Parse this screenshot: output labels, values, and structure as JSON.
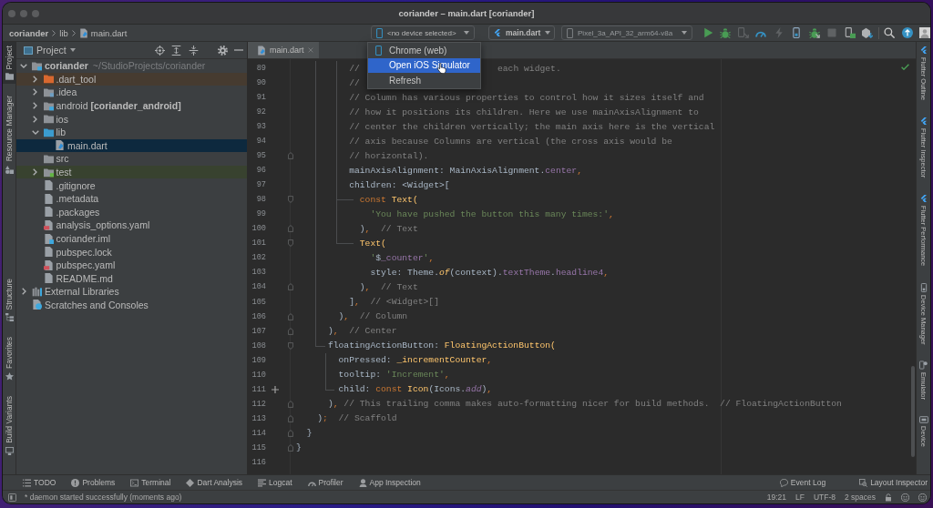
{
  "window": {
    "title": "coriander – main.dart [coriander]"
  },
  "breadcrumbs": [
    {
      "label": "coriander",
      "kind": "project"
    },
    {
      "label": "lib",
      "kind": "folder"
    },
    {
      "label": "main.dart",
      "kind": "dart"
    }
  ],
  "toolbar": {
    "device_selector": {
      "label": "<no device selected>"
    },
    "run_config": {
      "label": "main.dart"
    },
    "emulator_selector": {
      "label": "Pixel_3a_API_32_arm64-v8a",
      "disabled": true
    },
    "buttons": [
      {
        "kind": "run",
        "disabled": false
      },
      {
        "kind": "debug",
        "disabled": false
      },
      {
        "kind": "attach",
        "disabled": true
      },
      {
        "kind": "profile",
        "disabled": false
      },
      {
        "kind": "hot-reload",
        "disabled": true
      },
      {
        "kind": "device",
        "disabled": false
      },
      {
        "kind": "attach-debugger",
        "disabled": false
      },
      {
        "kind": "stop",
        "disabled": true
      },
      {
        "kind": "device-manager",
        "disabled": false
      },
      {
        "kind": "sdk-manager",
        "disabled": false
      },
      {
        "kind": "search",
        "disabled": false
      },
      {
        "kind": "update",
        "disabled": false
      },
      {
        "kind": "account",
        "disabled": false
      }
    ]
  },
  "device_menu": {
    "items": [
      {
        "label": "Chrome (web)",
        "kind": "device",
        "selected": false
      },
      {
        "label": "Open iOS Simulator",
        "kind": "action",
        "selected": true
      },
      {
        "label": "Refresh",
        "kind": "action",
        "selected": false
      }
    ]
  },
  "left_tool_strip": {
    "top": [
      {
        "label": "Project",
        "kind": "project",
        "selected": true
      },
      {
        "label": "Resource Manager",
        "kind": "resources",
        "selected": false
      }
    ],
    "bottom": [
      {
        "label": "Structure",
        "kind": "structure",
        "selected": false
      },
      {
        "label": "Favorites",
        "kind": "favorites",
        "selected": false
      },
      {
        "label": "Build Variants",
        "kind": "build-variants",
        "selected": false
      }
    ]
  },
  "project_panel": {
    "title": "Project",
    "tree": [
      {
        "name": "coriander",
        "path": "~/StudioProjects/coriander",
        "kind": "module",
        "expanded": true,
        "selected": false,
        "children": [
          {
            "name": ".dart_tool",
            "kind": "excluded",
            "expanded": false,
            "selected": false
          },
          {
            "name": ".idea",
            "kind": "config",
            "expanded": false,
            "selected": false
          },
          {
            "name": "android **[coriander_android]**",
            "kind": "android-module",
            "expanded": false,
            "selected": false
          },
          {
            "name": "ios",
            "kind": "folder",
            "expanded": false,
            "selected": false
          },
          {
            "name": "lib",
            "kind": "source",
            "expanded": true,
            "selected": false,
            "children": [
              {
                "name": "main.dart",
                "kind": "dart",
                "selected": true
              }
            ]
          },
          {
            "name": "src",
            "kind": "folder",
            "selected": false
          },
          {
            "name": "test",
            "kind": "test",
            "expanded": false,
            "selected": false
          },
          {
            "name": ".gitignore",
            "kind": "file",
            "selected": false
          },
          {
            "name": ".metadata",
            "kind": "file",
            "selected": false
          },
          {
            "name": ".packages",
            "kind": "file",
            "selected": false
          },
          {
            "name": "analysis_options.yaml",
            "kind": "yaml",
            "selected": false
          },
          {
            "name": "coriander.iml",
            "kind": "iml",
            "selected": false
          },
          {
            "name": "pubspec.lock",
            "kind": "file",
            "selected": false
          },
          {
            "name": "pubspec.yaml",
            "kind": "yaml",
            "selected": false
          },
          {
            "name": "README.md",
            "kind": "file",
            "selected": false
          }
        ]
      },
      {
        "name": "External Libraries",
        "kind": "libraries",
        "expanded": false,
        "selected": false
      },
      {
        "name": "Scratches and Consoles",
        "kind": "scratches",
        "selected": false
      }
    ]
  },
  "editor": {
    "tabs": [
      {
        "label": "main.dart",
        "kind": "dart",
        "selected": true
      }
    ],
    "lines": [
      {
        "n": "89",
        "tokens": [
          {
            "kind": "comment",
            "text": "          //"
          },
          {
            "kind": "comment",
            "text": "                          each widget."
          }
        ]
      },
      {
        "n": "90",
        "tokens": [
          {
            "kind": "comment",
            "text": "          //"
          }
        ]
      },
      {
        "n": "91",
        "tokens": [
          {
            "kind": "comment",
            "text": "          // Column has various properties to control how it sizes itself and"
          }
        ]
      },
      {
        "n": "92",
        "tokens": [
          {
            "kind": "comment",
            "text": "          // how it positions its children. Here we use mainAxisAlignment to"
          }
        ]
      },
      {
        "n": "93",
        "tokens": [
          {
            "kind": "comment",
            "text": "          // center the children vertically; the main axis here is the vertical"
          }
        ]
      },
      {
        "n": "94",
        "tokens": [
          {
            "kind": "comment",
            "text": "          // axis because Columns are vertical (the cross axis would be"
          }
        ]
      },
      {
        "n": "95",
        "gutter": {
          "kind": "fold-end"
        },
        "tokens": [
          {
            "kind": "comment",
            "text": "          // horizontal)."
          }
        ]
      },
      {
        "n": "96",
        "tokens": [
          {
            "kind": "plain",
            "text": "          mainAxisAlignment: MainAxisAlignment."
          },
          {
            "kind": "field",
            "text": "center"
          },
          {
            "kind": "punct",
            "text": ","
          }
        ]
      },
      {
        "n": "97",
        "tokens": [
          {
            "kind": "plain",
            "text": "          children: <Widget>["
          }
        ]
      },
      {
        "n": "98",
        "gutter": {
          "kind": "fold-start"
        },
        "tokens": [
          {
            "kind": "keyword",
            "text": "            const "
          },
          {
            "kind": "call",
            "text": "Text("
          }
        ]
      },
      {
        "n": "99",
        "tokens": [
          {
            "kind": "string",
            "text": "              'You have pushed the button this many times:'"
          },
          {
            "kind": "punct",
            "text": ","
          }
        ]
      },
      {
        "n": "100",
        "gutter": {
          "kind": "fold-end"
        },
        "tokens": [
          {
            "kind": "plain",
            "text": "            )"
          },
          {
            "kind": "punct",
            "text": ","
          },
          {
            "kind": "comment",
            "text": "  // Text"
          }
        ]
      },
      {
        "n": "101",
        "gutter": {
          "kind": "fold-start"
        },
        "tokens": [
          {
            "kind": "call",
            "text": "            Text("
          }
        ]
      },
      {
        "n": "102",
        "tokens": [
          {
            "kind": "string",
            "text": "              '"
          },
          {
            "kind": "plain",
            "text": "$"
          },
          {
            "kind": "field",
            "text": "_counter"
          },
          {
            "kind": "string",
            "text": "'"
          },
          {
            "kind": "punct",
            "text": ","
          }
        ]
      },
      {
        "n": "103",
        "tokens": [
          {
            "kind": "plain",
            "text": "              style: Theme."
          },
          {
            "kind": "static",
            "text": "of"
          },
          {
            "kind": "plain",
            "text": "(context)."
          },
          {
            "kind": "field",
            "text": "textTheme"
          },
          {
            "kind": "plain",
            "text": "."
          },
          {
            "kind": "field",
            "text": "headline4"
          },
          {
            "kind": "punct",
            "text": ","
          }
        ]
      },
      {
        "n": "104",
        "gutter": {
          "kind": "fold-end"
        },
        "tokens": [
          {
            "kind": "plain",
            "text": "            )"
          },
          {
            "kind": "punct",
            "text": ","
          },
          {
            "kind": "comment",
            "text": "  // Text"
          }
        ]
      },
      {
        "n": "105",
        "tokens": [
          {
            "kind": "plain",
            "text": "          ]"
          },
          {
            "kind": "punct",
            "text": ","
          },
          {
            "kind": "comment",
            "text": "  // <Widget>[]"
          }
        ]
      },
      {
        "n": "106",
        "gutter": {
          "kind": "fold-end"
        },
        "tokens": [
          {
            "kind": "plain",
            "text": "        )"
          },
          {
            "kind": "punct",
            "text": ","
          },
          {
            "kind": "comment",
            "text": "  // Column"
          }
        ]
      },
      {
        "n": "107",
        "gutter": {
          "kind": "fold-end"
        },
        "tokens": [
          {
            "kind": "plain",
            "text": "      )"
          },
          {
            "kind": "punct",
            "text": ","
          },
          {
            "kind": "comment",
            "text": "  // Center"
          }
        ]
      },
      {
        "n": "108",
        "gutter": {
          "kind": "fold-start"
        },
        "tokens": [
          {
            "kind": "plain",
            "text": "      floatingActionButton: "
          },
          {
            "kind": "call",
            "text": "FloatingActionButton("
          }
        ]
      },
      {
        "n": "109",
        "tokens": [
          {
            "kind": "plain",
            "text": "        onPressed: "
          },
          {
            "kind": "call",
            "text": "_incrementCounter"
          },
          {
            "kind": "punct",
            "text": ","
          }
        ]
      },
      {
        "n": "110",
        "tokens": [
          {
            "kind": "plain",
            "text": "        tooltip: "
          },
          {
            "kind": "string",
            "text": "'Increment'"
          },
          {
            "kind": "punct",
            "text": ","
          }
        ]
      },
      {
        "n": "111",
        "gutter": {
          "kind": "icon-preview"
        },
        "tokens": [
          {
            "kind": "plain",
            "text": "        child: "
          },
          {
            "kind": "keyword",
            "text": "const "
          },
          {
            "kind": "call",
            "text": "Icon"
          },
          {
            "kind": "plain",
            "text": "(Icons."
          },
          {
            "kind": "constant",
            "text": "add"
          },
          {
            "kind": "plain",
            "text": ")"
          },
          {
            "kind": "punct",
            "text": ","
          }
        ]
      },
      {
        "n": "112",
        "gutter": {
          "kind": "fold-end"
        },
        "tokens": [
          {
            "kind": "plain",
            "text": "      )"
          },
          {
            "kind": "punct",
            "text": ","
          },
          {
            "kind": "comment",
            "text": " // This trailing comma makes auto-formatting nicer for build methods.  // FloatingActionButton"
          }
        ]
      },
      {
        "n": "113",
        "gutter": {
          "kind": "fold-end"
        },
        "tokens": [
          {
            "kind": "plain",
            "text": "    )"
          },
          {
            "kind": "punct",
            "text": ";"
          },
          {
            "kind": "comment",
            "text": "  // Scaffold"
          }
        ]
      },
      {
        "n": "114",
        "gutter": {
          "kind": "fold-end"
        },
        "tokens": [
          {
            "kind": "plain",
            "text": "  }"
          }
        ]
      },
      {
        "n": "115",
        "gutter": {
          "kind": "fold-end"
        },
        "tokens": [
          {
            "kind": "plain",
            "text": "}"
          }
        ]
      },
      {
        "n": "116"
      }
    ]
  },
  "right_tool_strip": [
    {
      "label": "Flutter Outline",
      "kind": "flutter",
      "selected": false
    },
    {
      "label": "Flutter Inspector",
      "kind": "flutter",
      "selected": false
    },
    {
      "label": "Flutter Performance",
      "kind": "flutter",
      "selected": false
    },
    {
      "label": "Device Manager",
      "kind": "device-manager",
      "selected": false
    },
    {
      "label": "Emulator",
      "kind": "emulator",
      "selected": false
    },
    {
      "label": "Device",
      "kind": "device-files",
      "selected": false
    }
  ],
  "bottom_tools": {
    "left": [
      {
        "label": "TODO",
        "kind": "todo"
      },
      {
        "label": "Problems",
        "kind": "problems"
      },
      {
        "label": "Terminal",
        "kind": "terminal"
      },
      {
        "label": "Dart Analysis",
        "kind": "analysis"
      },
      {
        "label": "Logcat",
        "kind": "logcat"
      },
      {
        "label": "Profiler",
        "kind": "profiler"
      },
      {
        "label": "App Inspection",
        "kind": "inspection"
      }
    ],
    "right": [
      {
        "label": "Event Log",
        "kind": "event-log"
      },
      {
        "label": "Layout Inspector",
        "kind": "layout-inspector"
      }
    ]
  },
  "status_bar": {
    "message": "* daemon started successfully (moments ago)",
    "items": [
      "19:21",
      "LF",
      "UTF-8",
      "2 spaces"
    ]
  }
}
